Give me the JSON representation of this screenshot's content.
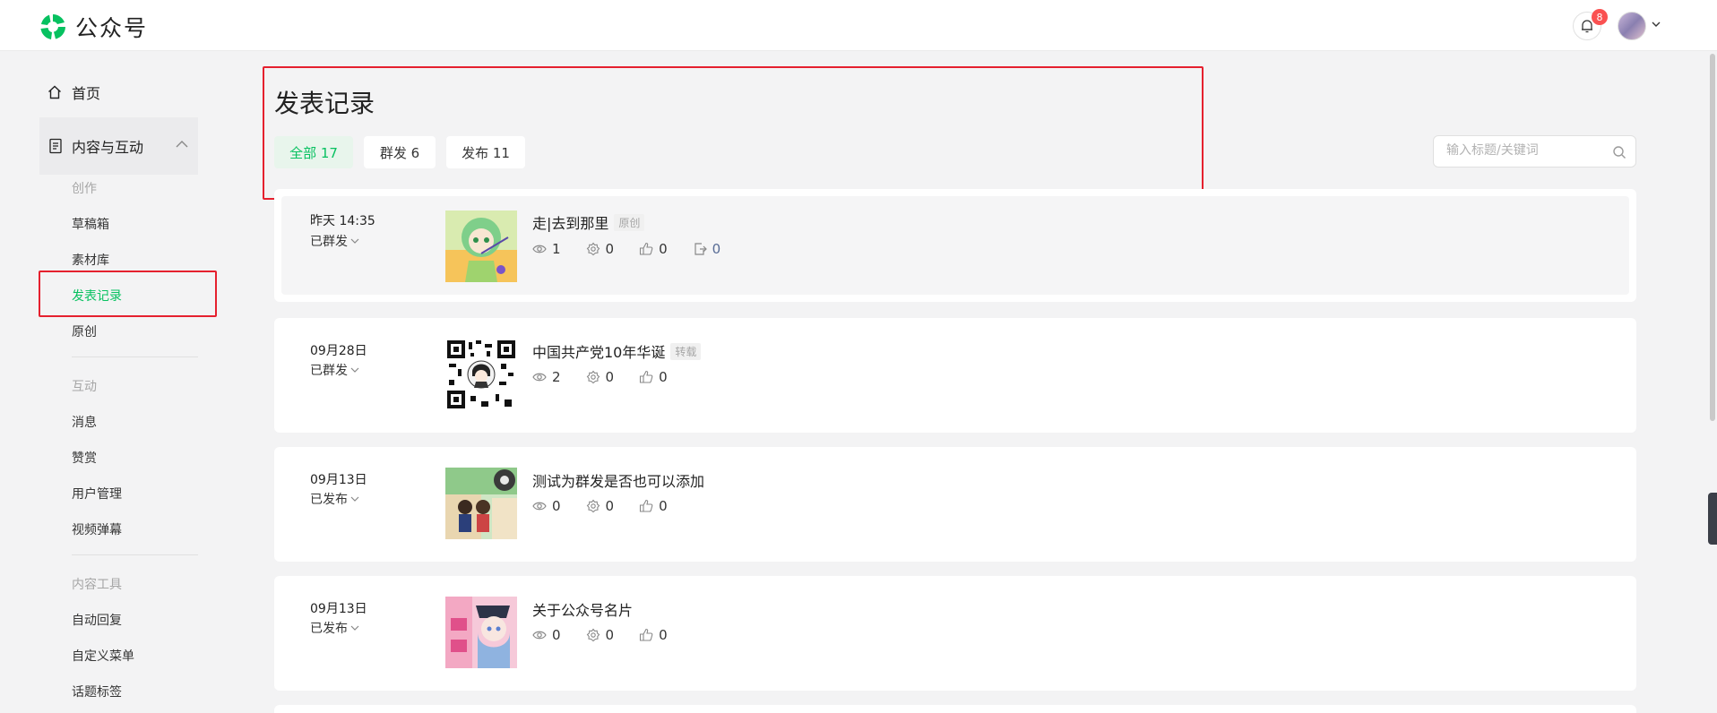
{
  "app": {
    "name": "公众号",
    "brand_color": "#07c160"
  },
  "header": {
    "notification_count": "8"
  },
  "sidebar": {
    "home": "首页",
    "group": "内容与互动",
    "sections": [
      {
        "title": "创作",
        "items": [
          "草稿箱",
          "素材库",
          "发表记录",
          "原创"
        ]
      },
      {
        "title": "互动",
        "items": [
          "消息",
          "赞赏",
          "用户管理",
          "视频弹幕"
        ]
      },
      {
        "title": "内容工具",
        "items": [
          "自动回复",
          "自定义菜单",
          "话题标签"
        ]
      }
    ],
    "active_item": "发表记录"
  },
  "main": {
    "title": "发表记录",
    "tabs": [
      {
        "label": "全部 17",
        "active": true
      },
      {
        "label": "群发 6",
        "active": false
      },
      {
        "label": "发布 11",
        "active": false
      }
    ],
    "search": {
      "placeholder": "输入标题/关键词",
      "value": ""
    },
    "records": [
      {
        "date": "昨天 14:35",
        "status": "已群发",
        "title": "走|去到那里",
        "tag": "原创",
        "views": "1",
        "recommends": "0",
        "likes": "0",
        "shares": "0",
        "thumb": "green-character"
      },
      {
        "date": "09月28日",
        "status": "已群发",
        "title": "中国共产党10年华诞",
        "tag": "转载",
        "views": "2",
        "recommends": "0",
        "likes": "0",
        "thumb": "qr-code"
      },
      {
        "date": "09月13日",
        "status": "已发布",
        "title": "测试为群发是否也可以添加",
        "views": "0",
        "recommends": "0",
        "likes": "0",
        "thumb": "anime-scene"
      },
      {
        "date": "09月13日",
        "status": "已发布",
        "title": "关于公众号名片",
        "views": "0",
        "recommends": "0",
        "likes": "0",
        "thumb": "anime-poster"
      }
    ]
  }
}
